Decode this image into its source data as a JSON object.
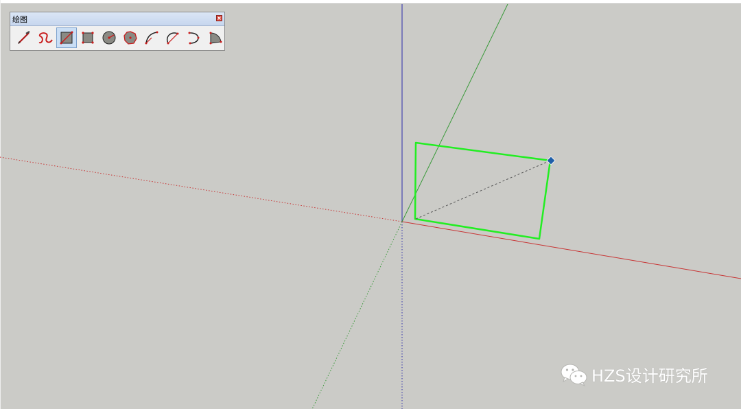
{
  "toolbar": {
    "title": "绘图",
    "tools": [
      {
        "icon": "pencil-line-icon"
      },
      {
        "icon": "freehand-icon"
      },
      {
        "icon": "rectangle-icon",
        "active": true
      },
      {
        "icon": "rotated-rectangle-icon"
      },
      {
        "icon": "circle-icon"
      },
      {
        "icon": "polygon-icon"
      },
      {
        "icon": "arc-icon"
      },
      {
        "icon": "two-point-arc-icon"
      },
      {
        "icon": "three-point-arc-icon"
      },
      {
        "icon": "pie-icon"
      }
    ]
  },
  "scene": {
    "axis_colors": {
      "red": "#c83232",
      "green": "#3a9a3a",
      "blue": "#2a2aa8"
    },
    "rectangle_color": "#22ee22",
    "endpoint_color": "#1f5ea8",
    "background": "#cbcbc7"
  },
  "watermark": {
    "text": "HZS设计研究所",
    "icon": "wechat-icon"
  }
}
